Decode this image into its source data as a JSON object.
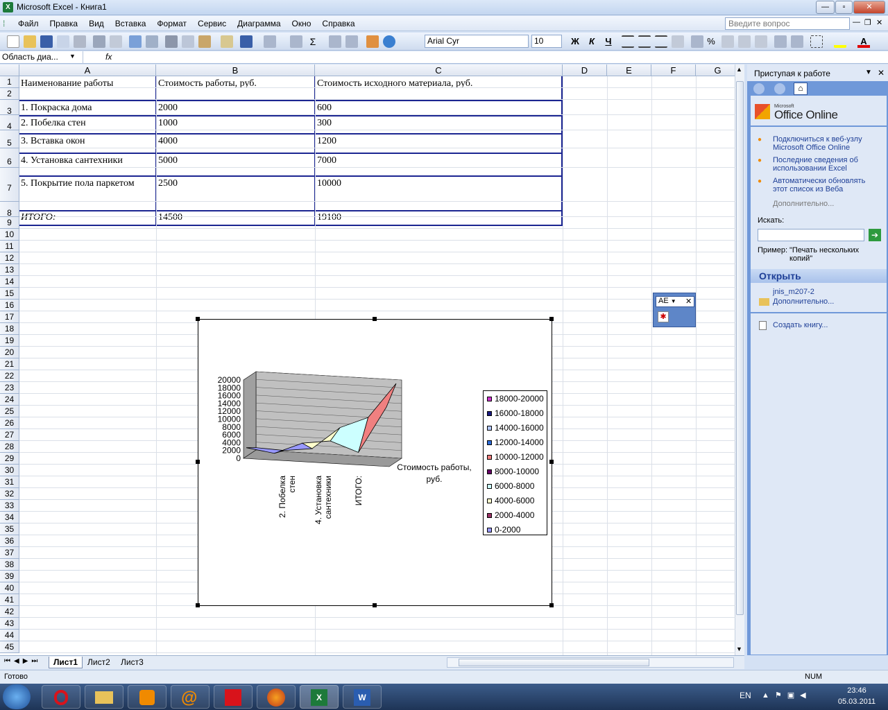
{
  "window": {
    "title": "Microsoft Excel - Книга1"
  },
  "menu": [
    "Файл",
    "Правка",
    "Вид",
    "Вставка",
    "Формат",
    "Сервис",
    "Диаграмма",
    "Окно",
    "Справка"
  ],
  "help_placeholder": "Введите вопрос",
  "format": {
    "font": "Arial Cyr",
    "size": "10",
    "bold": "Ж",
    "italic": "К",
    "underline": "Ч"
  },
  "formula": {
    "name_box": "Область диа...",
    "fx": "fx"
  },
  "columns": [
    "A",
    "B",
    "C",
    "D",
    "E",
    "F",
    "G"
  ],
  "rows": [
    "1",
    "2",
    "3",
    "4",
    "5",
    "6",
    "7",
    "8",
    "9",
    "10",
    "11",
    "12",
    "13",
    "14",
    "15",
    "16",
    "17",
    "18",
    "19",
    "20",
    "21",
    "22",
    "23",
    "24",
    "25",
    "26",
    "27",
    "28",
    "29",
    "30",
    "31",
    "32",
    "33",
    "34",
    "35",
    "36",
    "37",
    "38",
    "39",
    "40",
    "41",
    "42",
    "43",
    "44",
    "45"
  ],
  "table": {
    "headers": [
      "Наименование работы",
      "Стоимость работы, руб.",
      "Стоимость исходного материала, руб."
    ],
    "rows": [
      [
        "1. Покраска дома",
        "2000",
        "600"
      ],
      [
        "2. Побелка стен",
        "1000",
        "300"
      ],
      [
        "3. Вставка окон",
        "4000",
        "1200"
      ],
      [
        "4. Установка сантехники",
        "5000",
        "7000"
      ],
      [
        "5. Покрытие пола паркетом",
        "2500",
        "10000"
      ]
    ],
    "total": [
      "ИТОГО:",
      "14500",
      "19100"
    ]
  },
  "chart_data": {
    "type": "surface",
    "x_categories": [
      "2. Побелка стен",
      "4. Установка сантехники",
      "ИТОГО:"
    ],
    "z_label": "Стоимость работы, руб.",
    "y_ticks": [
      "20000",
      "18000",
      "16000",
      "14000",
      "12000",
      "10000",
      "8000",
      "6000",
      "4000",
      "2000",
      "0"
    ],
    "ylim": [
      0,
      20000
    ],
    "legend": [
      {
        "label": "18000-20000",
        "color": "#cc33cc"
      },
      {
        "label": "16000-18000",
        "color": "#1a1a80"
      },
      {
        "label": "14000-16000",
        "color": "#b3c8ff"
      },
      {
        "label": "12000-14000",
        "color": "#2e6bd6"
      },
      {
        "label": "10000-12000",
        "color": "#f08080"
      },
      {
        "label": "8000-10000",
        "color": "#660066"
      },
      {
        "label": "6000-8000",
        "color": "#ccffff"
      },
      {
        "label": "4000-6000",
        "color": "#ffffcc"
      },
      {
        "label": "2000-4000",
        "color": "#993366"
      },
      {
        "label": "0-2000",
        "color": "#9999ff"
      }
    ]
  },
  "taskpane": {
    "title": "Приступая к работе",
    "brand_small": "Microsoft",
    "brand": "Office Online",
    "links": [
      "Подключиться к веб-узлу Microsoft Office Online",
      "Последние сведения об использовании Excel",
      "Автоматически обновлять этот список из Веба"
    ],
    "more": "Дополнительно...",
    "search_label": "Искать:",
    "example_label": "Пример:",
    "example_text": "\"Печать нескольких копий\"",
    "open_title": "Открыть",
    "recent_file": "jnis_m207-2",
    "open_more": "Дополнительно...",
    "create": "Создать книгу..."
  },
  "float_toolbar": {
    "label": "AE"
  },
  "sheets": [
    "Лист1",
    "Лист2",
    "Лист3"
  ],
  "status": {
    "ready": "Готово",
    "num": "NUM"
  },
  "taskbar": {
    "lang": "EN",
    "time": "23:46",
    "date": "05.03.2011"
  }
}
